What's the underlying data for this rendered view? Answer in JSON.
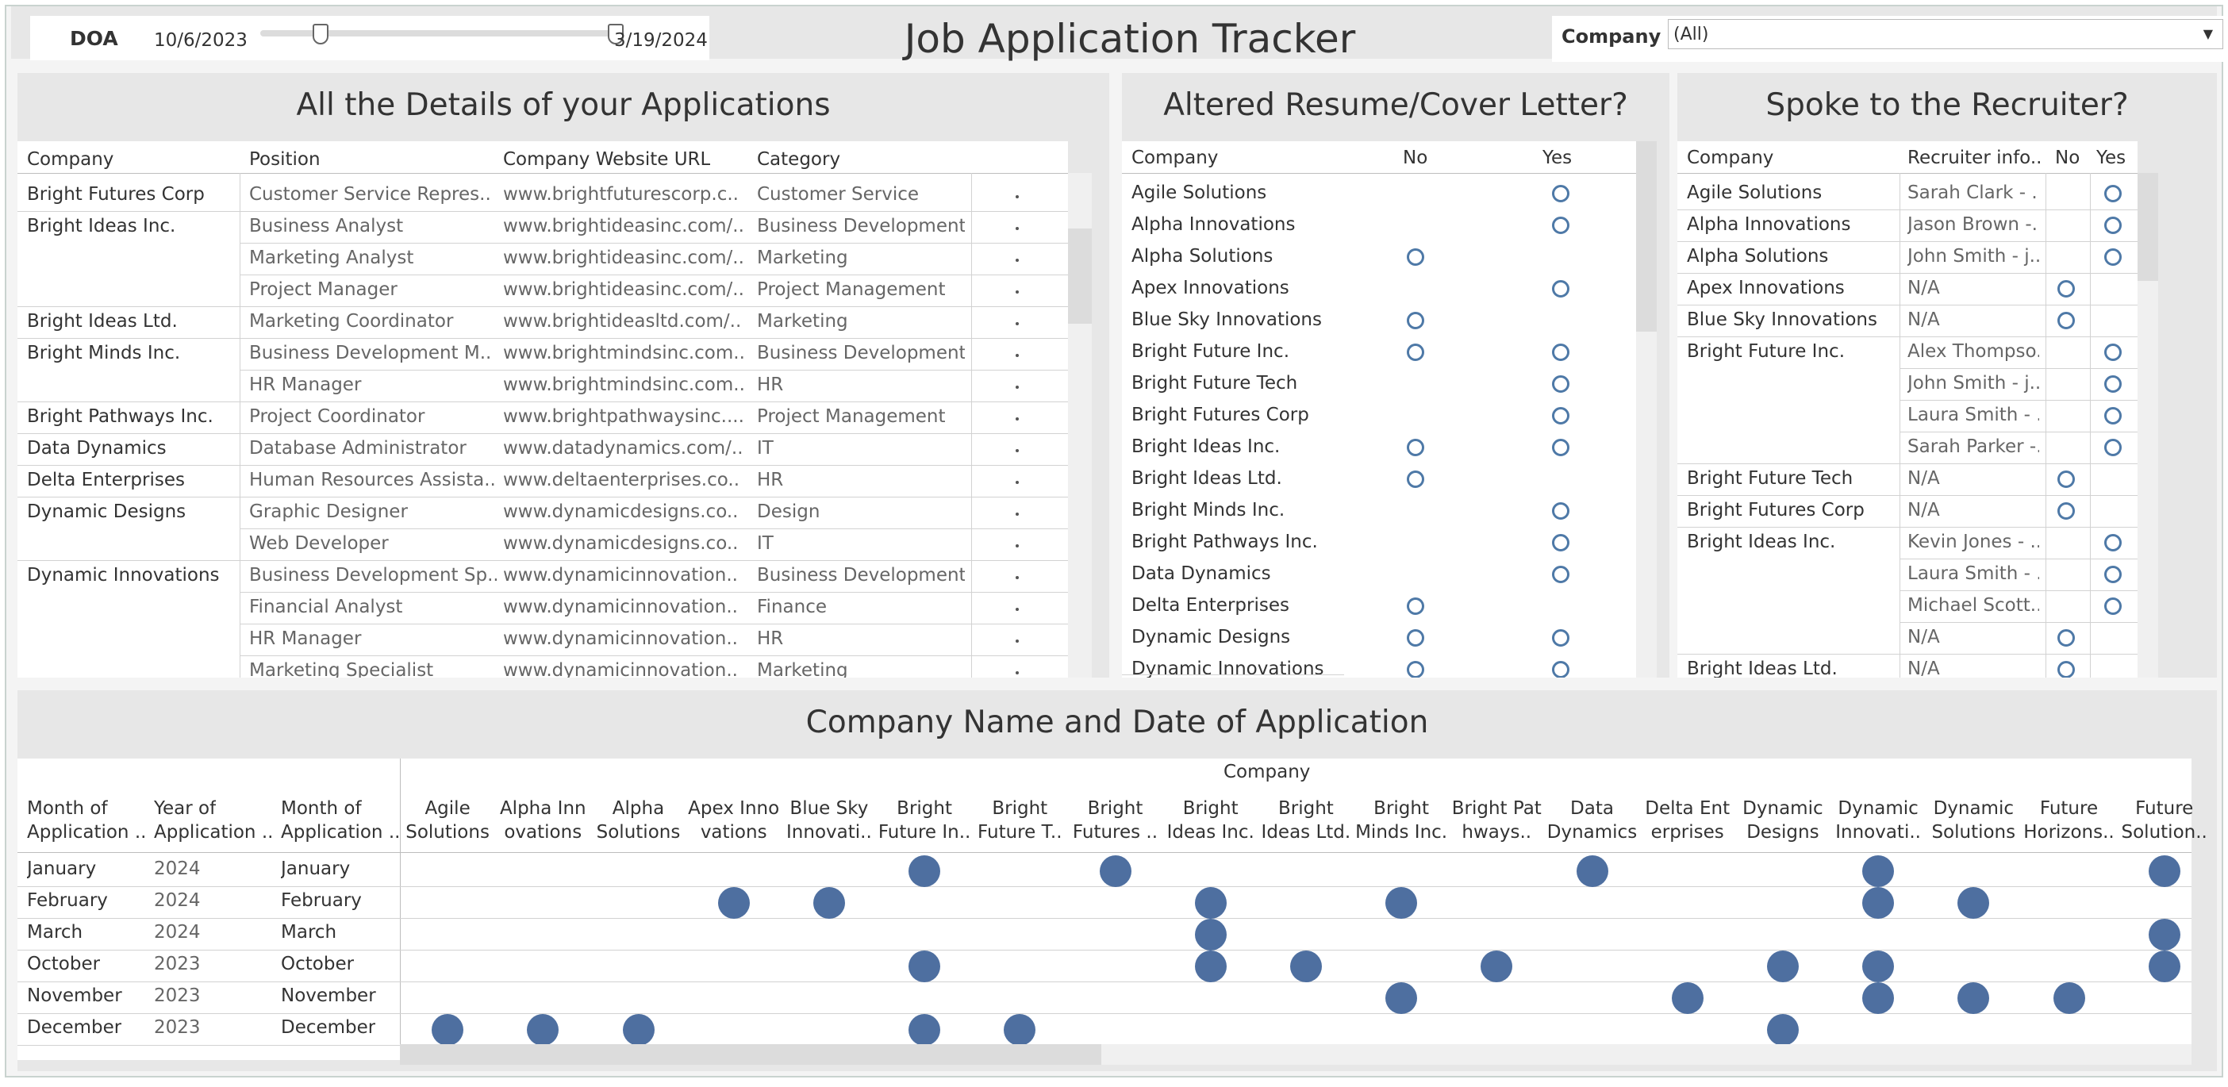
{
  "filters": {
    "doa_label": "DOA",
    "doa_start": "10/6/2023",
    "doa_end": "3/19/2024",
    "company_label": "Company",
    "company_value": "(All)"
  },
  "title": "Job Application Tracker",
  "details": {
    "title": "All the Details of your Applications",
    "headers": [
      "Company",
      "Position",
      "Company Website URL",
      "Category"
    ],
    "rows": [
      {
        "company": "Bright Futures Corp",
        "position": "Customer Service Repres..",
        "url": "www.brightfuturescorp.c..",
        "category": "Customer Service"
      },
      {
        "company": "Bright Ideas Inc.",
        "position": "Business Analyst",
        "url": "www.brightideasinc.com/..",
        "category": "Business Development"
      },
      {
        "company": "",
        "position": "Marketing Analyst",
        "url": "www.brightideasinc.com/..",
        "category": "Marketing"
      },
      {
        "company": "",
        "position": "Project Manager",
        "url": "www.brightideasinc.com/..",
        "category": "Project Management"
      },
      {
        "company": "Bright Ideas Ltd.",
        "position": "Marketing Coordinator",
        "url": "www.brightideasltd.com/..",
        "category": "Marketing"
      },
      {
        "company": "Bright Minds Inc.",
        "position": "Business Development M..",
        "url": "www.brightmindsinc.com..",
        "category": "Business Development"
      },
      {
        "company": "",
        "position": "HR Manager",
        "url": "www.brightmindsinc.com..",
        "category": "HR"
      },
      {
        "company": "Bright Pathways Inc.",
        "position": "Project Coordinator",
        "url": "www.brightpathwaysinc....",
        "category": "Project Management"
      },
      {
        "company": "Data Dynamics",
        "position": "Database Administrator",
        "url": "www.datadynamics.com/..",
        "category": "IT"
      },
      {
        "company": "Delta Enterprises",
        "position": "Human Resources Assista..",
        "url": "www.deltaenterprises.co..",
        "category": "HR"
      },
      {
        "company": "Dynamic Designs",
        "position": "Graphic Designer",
        "url": "www.dynamicdesigns.co..",
        "category": "Design"
      },
      {
        "company": "",
        "position": "Web Developer",
        "url": "www.dynamicdesigns.co..",
        "category": "IT"
      },
      {
        "company": "Dynamic Innovations",
        "position": "Business Development Sp..",
        "url": "www.dynamicinnovation..",
        "category": "Business Development"
      },
      {
        "company": "",
        "position": "Financial Analyst",
        "url": "www.dynamicinnovation..",
        "category": "Finance"
      },
      {
        "company": "",
        "position": "HR Manager",
        "url": "www.dynamicinnovation..",
        "category": "HR"
      },
      {
        "company": "",
        "position": "Marketing Specialist",
        "url": "www.dynamicinnovation..",
        "category": "Marketing"
      }
    ]
  },
  "resume": {
    "title": "Altered Resume/Cover Letter?",
    "headers": [
      "Company",
      "No",
      "Yes"
    ],
    "rows": [
      {
        "company": "Agile Solutions",
        "no": false,
        "yes": true
      },
      {
        "company": "Alpha Innovations",
        "no": false,
        "yes": true
      },
      {
        "company": "Alpha Solutions",
        "no": true,
        "yes": false
      },
      {
        "company": "Apex Innovations",
        "no": false,
        "yes": true
      },
      {
        "company": "Blue Sky Innovations",
        "no": true,
        "yes": false
      },
      {
        "company": "Bright Future Inc.",
        "no": true,
        "yes": true
      },
      {
        "company": "Bright Future Tech",
        "no": false,
        "yes": true
      },
      {
        "company": "Bright Futures Corp",
        "no": false,
        "yes": true
      },
      {
        "company": "Bright Ideas Inc.",
        "no": true,
        "yes": true
      },
      {
        "company": "Bright Ideas Ltd.",
        "no": true,
        "yes": false
      },
      {
        "company": "Bright Minds Inc.",
        "no": false,
        "yes": true
      },
      {
        "company": "Bright Pathways Inc.",
        "no": false,
        "yes": true
      },
      {
        "company": "Data Dynamics",
        "no": false,
        "yes": true
      },
      {
        "company": "Delta Enterprises",
        "no": true,
        "yes": false
      },
      {
        "company": "Dynamic Designs",
        "no": true,
        "yes": true
      },
      {
        "company": "Dynamic Innovations",
        "no": true,
        "yes": true
      }
    ]
  },
  "recruiter": {
    "title": "Spoke to the Recruiter?",
    "headers": [
      "Company",
      "Recruiter info..",
      "No",
      "Yes"
    ],
    "rows": [
      {
        "company": "Agile Solutions",
        "info": "Sarah Clark - ..",
        "no": false,
        "yes": true
      },
      {
        "company": "Alpha Innovations",
        "info": "Jason Brown -..",
        "no": false,
        "yes": true
      },
      {
        "company": "Alpha Solutions",
        "info": "John Smith - j..",
        "no": false,
        "yes": true
      },
      {
        "company": "Apex Innovations",
        "info": "N/A",
        "no": true,
        "yes": false
      },
      {
        "company": "Blue Sky Innovations",
        "info": "N/A",
        "no": true,
        "yes": false
      },
      {
        "company": "Bright Future Inc.",
        "info": "Alex Thompso..",
        "no": false,
        "yes": true
      },
      {
        "company": "",
        "info": "John Smith - j..",
        "no": false,
        "yes": true
      },
      {
        "company": "",
        "info": "Laura Smith - ..",
        "no": false,
        "yes": true
      },
      {
        "company": "",
        "info": "Sarah Parker -..",
        "no": false,
        "yes": true
      },
      {
        "company": "Bright Future Tech",
        "info": "N/A",
        "no": true,
        "yes": false
      },
      {
        "company": "Bright Futures Corp",
        "info": "N/A",
        "no": true,
        "yes": false
      },
      {
        "company": "Bright Ideas Inc.",
        "info": "Kevin Jones - ..",
        "no": false,
        "yes": true
      },
      {
        "company": "",
        "info": "Laura Smith - ..",
        "no": false,
        "yes": true
      },
      {
        "company": "",
        "info": "Michael Scott..",
        "no": false,
        "yes": true
      },
      {
        "company": "",
        "info": "N/A",
        "no": true,
        "yes": false
      },
      {
        "company": "Bright Ideas Ltd.",
        "info": "N/A",
        "no": true,
        "yes": false
      }
    ]
  },
  "timeline": {
    "title": "Company Name and Date of Application",
    "company_header": "Company",
    "row_headers": [
      [
        "Month of",
        "Application .."
      ],
      [
        "Year of",
        "Application .."
      ],
      [
        "Month of",
        "Application .."
      ]
    ],
    "companies": [
      [
        "Agile",
        "Solutions"
      ],
      [
        "Alpha Inn",
        "ovations"
      ],
      [
        "Alpha",
        "Solutions"
      ],
      [
        "Apex Inno",
        "vations"
      ],
      [
        "Blue Sky",
        "Innovati.."
      ],
      [
        "Bright",
        "Future In.."
      ],
      [
        "Bright",
        "Future T.."
      ],
      [
        "Bright",
        "Futures .."
      ],
      [
        "Bright",
        "Ideas Inc."
      ],
      [
        "Bright",
        "Ideas Ltd."
      ],
      [
        "Bright",
        "Minds Inc."
      ],
      [
        "Bright Pat",
        "hways.."
      ],
      [
        "Data",
        "Dynamics"
      ],
      [
        "Delta Ent",
        "erprises"
      ],
      [
        "Dynamic",
        "Designs"
      ],
      [
        "Dynamic",
        "Innovati.."
      ],
      [
        "Dynamic",
        "Solutions"
      ],
      [
        "Future",
        "Horizons.."
      ],
      [
        "Future",
        "Solution.."
      ]
    ],
    "rows": [
      {
        "month": "January",
        "year": "2024",
        "month2": "January",
        "marks": [
          5,
          7,
          12,
          15,
          18
        ]
      },
      {
        "month": "February",
        "year": "2024",
        "month2": "February",
        "marks": [
          3,
          4,
          8,
          10,
          15,
          16
        ]
      },
      {
        "month": "March",
        "year": "2024",
        "month2": "March",
        "marks": [
          8,
          18
        ]
      },
      {
        "month": "October",
        "year": "2023",
        "month2": "October",
        "marks": [
          5,
          8,
          9,
          11,
          14,
          15,
          18
        ]
      },
      {
        "month": "November",
        "year": "2023",
        "month2": "November",
        "marks": [
          10,
          13,
          15,
          16,
          17
        ]
      },
      {
        "month": "December",
        "year": "2023",
        "month2": "December",
        "marks": [
          0,
          1,
          2,
          5,
          6,
          14
        ]
      }
    ]
  },
  "colors": {
    "mark": "#4e6fa0",
    "ring": "#4e79a7",
    "panel_bg": "#e7e7e7"
  }
}
